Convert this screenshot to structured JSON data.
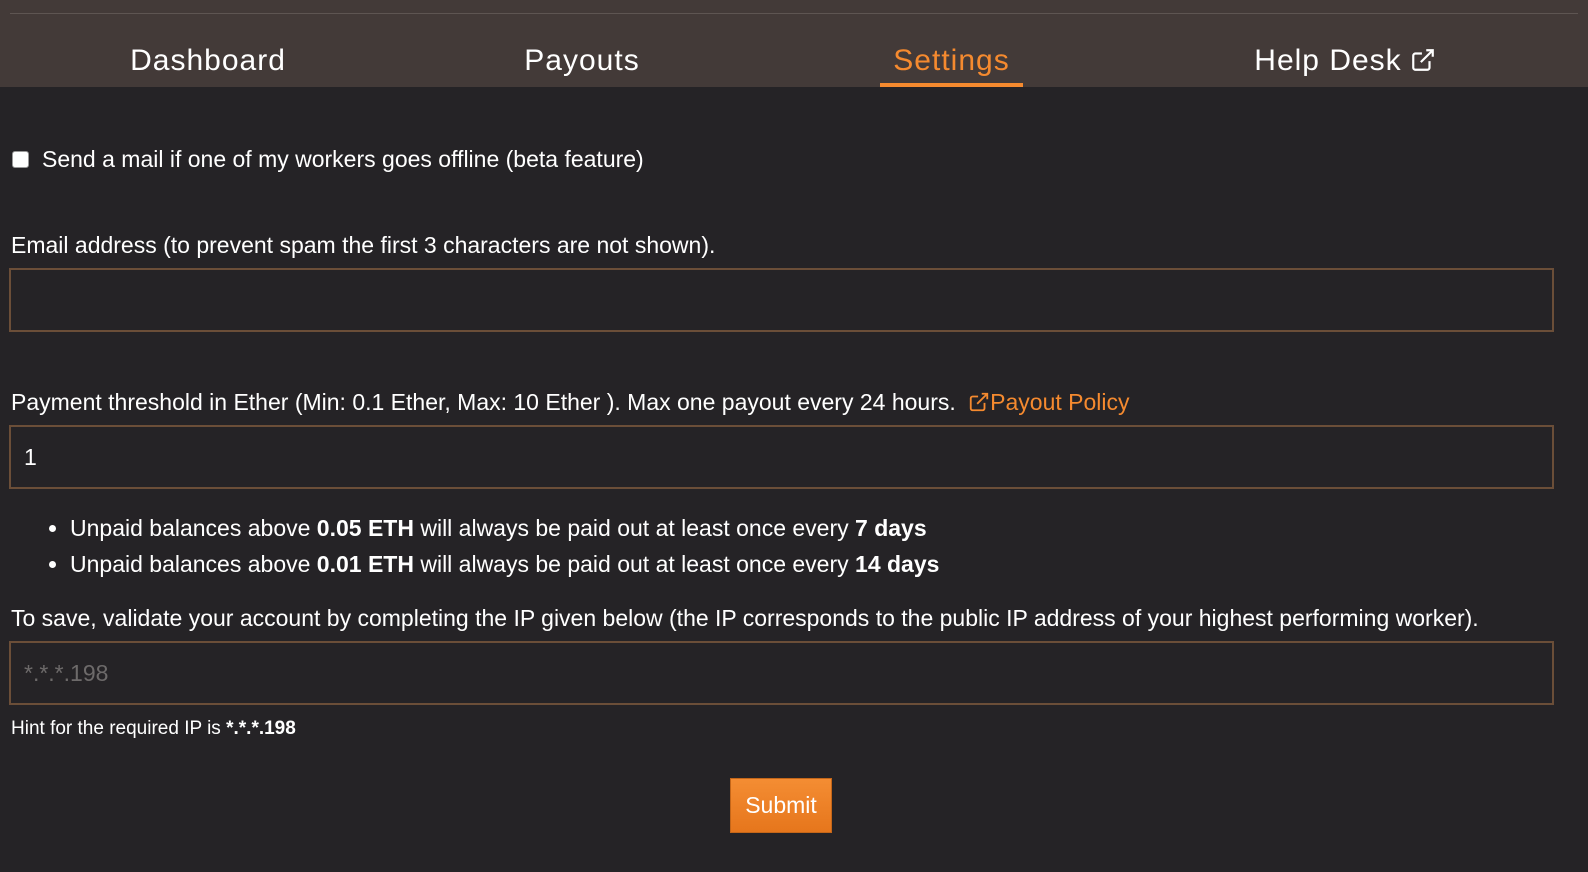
{
  "nav": {
    "tabs": [
      {
        "label": "Dashboard"
      },
      {
        "label": "Payouts"
      },
      {
        "label": "Settings",
        "active": true
      },
      {
        "label": "Help Desk"
      }
    ]
  },
  "settings": {
    "offline_mail_label": "Send a mail if one of my workers goes offline (beta feature)",
    "offline_mail_checked": false,
    "email_label": "Email address (to prevent spam the first 3 characters are not shown).",
    "email_value": "",
    "threshold_label": "Payment threshold in Ether (Min: 0.1 Ether, Max: 10 Ether ). Max one payout every 24 hours.",
    "payout_policy_link": "Payout Policy",
    "threshold_value": "1",
    "bullets": [
      {
        "pre": "Unpaid balances above ",
        "amount": "0.05 ETH",
        "mid": " will always be paid out at least once every ",
        "period": "7 days"
      },
      {
        "pre": "Unpaid balances above ",
        "amount": "0.01 ETH",
        "mid": " will always be paid out at least once every ",
        "period": "14 days"
      }
    ],
    "ip_label": "To save, validate your account by completing the IP given below (the IP corresponds to the public IP address of your highest performing worker).",
    "ip_placeholder": "*.*.*.198",
    "hint_prefix": "Hint for the required IP is ",
    "hint_ip": "*.*.*.198",
    "submit_label": "Submit"
  },
  "colors": {
    "accent": "#f58a2f",
    "topbar": "#433a38",
    "background": "#252326",
    "input_border": "#6b4e38"
  }
}
